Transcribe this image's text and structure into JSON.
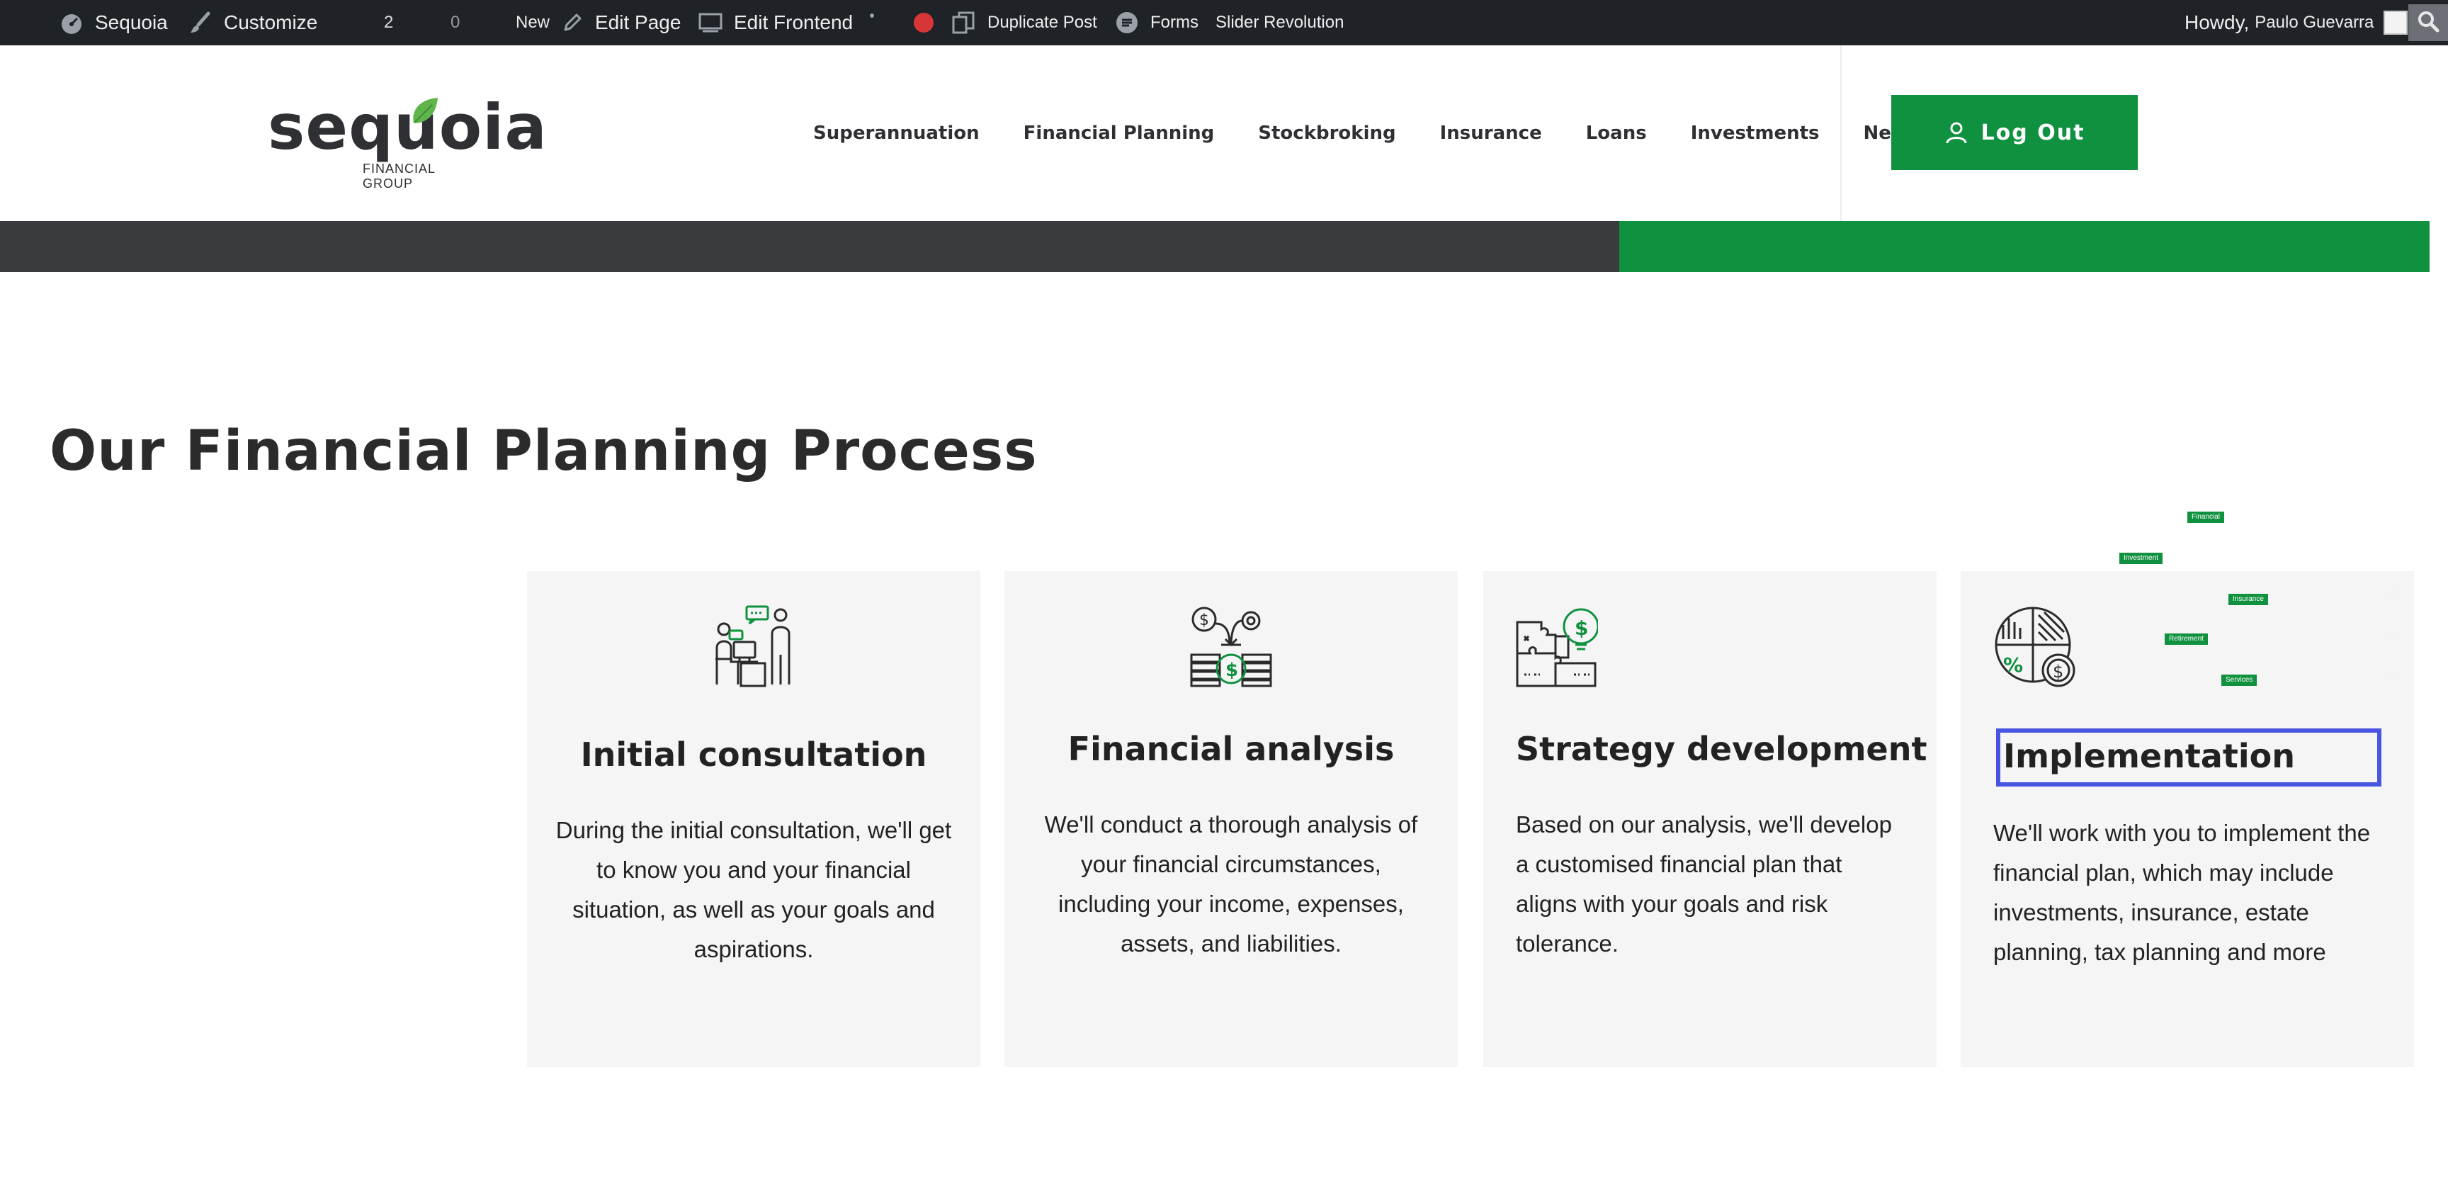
{
  "adminbar": {
    "site_name": "Sequoia",
    "customize": "Customize",
    "updates_count": "2",
    "comments_count": "0",
    "new": "New",
    "edit_page": "Edit Page",
    "edit_frontend": "Edit Frontend",
    "duplicate_post": "Duplicate Post",
    "forms": "Forms",
    "slider_revolution": "Slider Revolution",
    "howdy": "Howdy,",
    "user_name": "Paulo Guevarra"
  },
  "header": {
    "logo_word": "sequoia",
    "logo_sub": "FINANCIAL GROUP",
    "nav": [
      "Superannuation",
      "Financial Planning",
      "Stockbroking",
      "Insurance",
      "Loans",
      "Investments",
      "News"
    ],
    "logout_label": "Log Out"
  },
  "section": {
    "title": "Our Financial Planning Process",
    "cards": [
      {
        "icon": "consultation-icon",
        "title": "Initial consultation",
        "text": "During the initial consultation, we'll get to know you and your financial situation, as well as your goals and aspirations."
      },
      {
        "icon": "financial-analysis-icon",
        "title": "Financial analysis",
        "text": "We'll conduct a thorough analysis of your financial circumstances, including your income, expenses, assets, and liabilities."
      },
      {
        "icon": "strategy-puzzle-icon",
        "title": "Strategy development",
        "text": "Based on our analysis, we'll develop a customised financial plan that aligns with your goals and risk tolerance."
      },
      {
        "icon": "pie-chart-dollar-icon",
        "title": "Implementation",
        "text": "We'll work with you to implement the financial plan, which may include investments, insurance, estate planning, tax planning and more"
      }
    ]
  },
  "floating_labels": [
    "Financial",
    "Investment",
    "Insurance",
    "Retirement",
    "Services"
  ],
  "colors": {
    "adminbar_bg": "#1f2327",
    "brand_green": "#10913f",
    "strip_dark": "#3a3b3f",
    "card_bg": "#f5f5f5",
    "focus_outline": "#4855e0",
    "record_dot": "#d63638"
  }
}
